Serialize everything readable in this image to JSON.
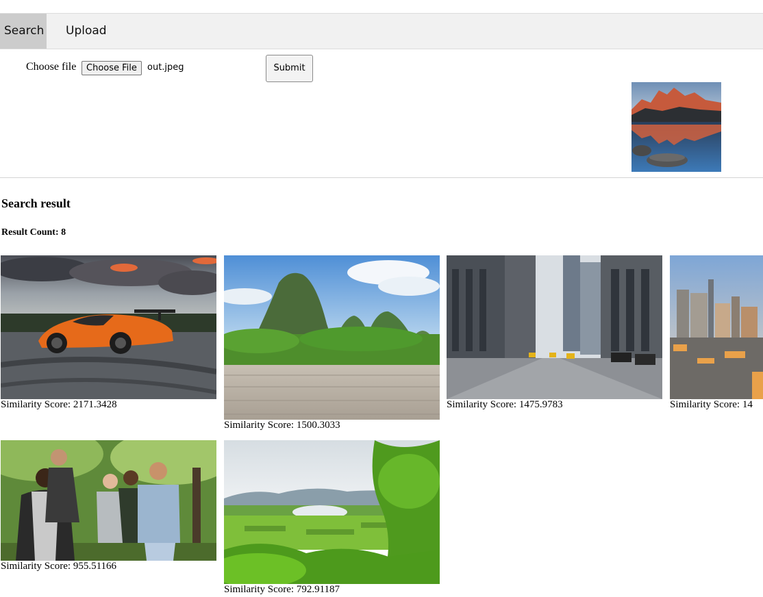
{
  "nav": {
    "tabs": [
      "Search",
      "Upload"
    ]
  },
  "form": {
    "label": "Choose file",
    "file_button": "Choose File",
    "file_name": "out.jpeg",
    "submit_label": "Submit"
  },
  "results": {
    "heading": "Search result",
    "count_text": "Result Count: 8",
    "items": [
      {
        "score": "Similarity Score: 2171.3428"
      },
      {
        "score": "Similarity Score: 1500.3033"
      },
      {
        "score": "Similarity Score: 1475.9783"
      },
      {
        "score": "Similarity Score: 14"
      },
      {
        "score": "Similarity Score: 955.51166"
      },
      {
        "score": "Similarity Score: 792.91187"
      }
    ]
  },
  "colors": {
    "nav_bg": "#f1f1f1",
    "nav_active": "#cccccc"
  }
}
